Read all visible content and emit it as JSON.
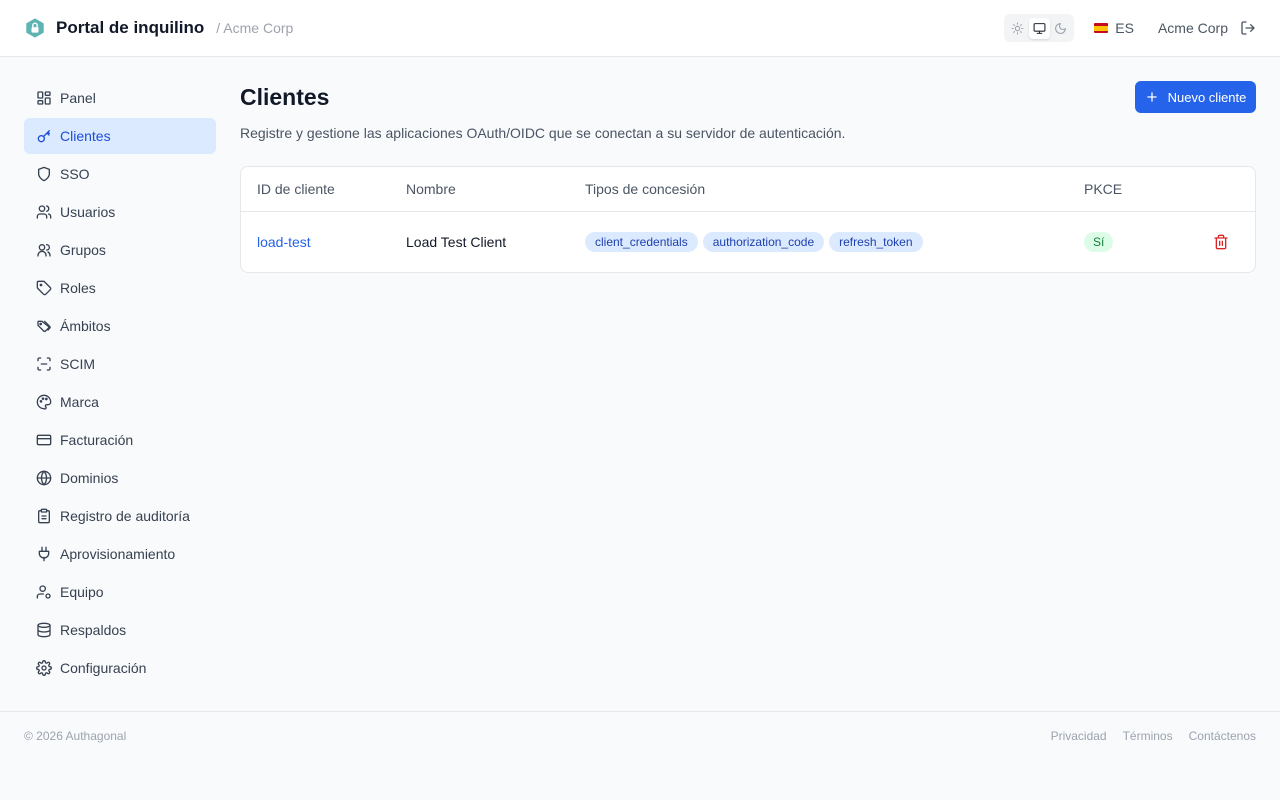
{
  "header": {
    "title": "Portal de inquilino",
    "tenant": "/ Acme Corp",
    "language": "ES",
    "org": "Acme Corp",
    "theme_options": [
      "light",
      "system",
      "dark"
    ],
    "theme_selected": "system"
  },
  "sidebar": {
    "items": [
      {
        "label": "Panel",
        "icon": "grid-icon",
        "active": false
      },
      {
        "label": "Clientes",
        "icon": "key-icon",
        "active": true
      },
      {
        "label": "SSO",
        "icon": "shield-icon",
        "active": false
      },
      {
        "label": "Usuarios",
        "icon": "users-icon",
        "active": false
      },
      {
        "label": "Grupos",
        "icon": "group-icon",
        "active": false
      },
      {
        "label": "Roles",
        "icon": "tag-icon",
        "active": false
      },
      {
        "label": "Ámbitos",
        "icon": "tags-icon",
        "active": false
      },
      {
        "label": "SCIM",
        "icon": "scan-icon",
        "active": false
      },
      {
        "label": "Marca",
        "icon": "palette-icon",
        "active": false
      },
      {
        "label": "Facturación",
        "icon": "credit-card-icon",
        "active": false
      },
      {
        "label": "Dominios",
        "icon": "globe-icon",
        "active": false
      },
      {
        "label": "Registro de auditoría",
        "icon": "clipboard-icon",
        "active": false
      },
      {
        "label": "Aprovisionamiento",
        "icon": "plug-icon",
        "active": false
      },
      {
        "label": "Equipo",
        "icon": "user-cog-icon",
        "active": false
      },
      {
        "label": "Respaldos",
        "icon": "database-icon",
        "active": false
      },
      {
        "label": "Configuración",
        "icon": "settings-icon",
        "active": false
      }
    ]
  },
  "main": {
    "title": "Clientes",
    "description": "Registre y gestione las aplicaciones OAuth/OIDC que se conectan a su servidor de autenticación.",
    "new_button": "Nuevo cliente",
    "table": {
      "columns": [
        "ID de cliente",
        "Nombre",
        "Tipos de concesión",
        "PKCE"
      ],
      "rows": [
        {
          "id": "load-test",
          "name": "Load Test Client",
          "grants": [
            "client_credentials",
            "authorization_code",
            "refresh_token"
          ],
          "pkce": "Sí"
        }
      ]
    }
  },
  "footer": {
    "copyright": "© 2026 Authagonal",
    "links": [
      "Privacidad",
      "Términos",
      "Contáctenos"
    ]
  },
  "colors": {
    "accent": "#2563eb",
    "active_nav_bg": "#dbeafe",
    "danger": "#dc2626",
    "success_bg": "#dcfce7",
    "logo": "#5eb3b3"
  }
}
